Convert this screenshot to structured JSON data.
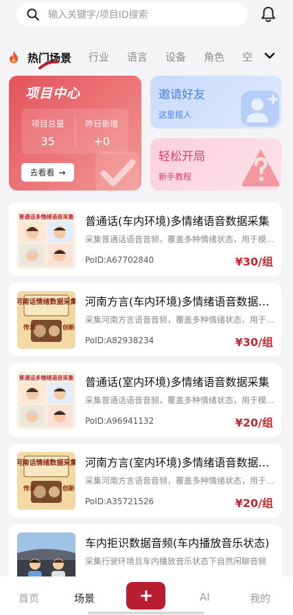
{
  "search": {
    "placeholder": "输入关键字/项目ID搜索",
    "icon": "search-icon"
  },
  "tabs": [
    {
      "label": "热门场景",
      "active": true
    },
    {
      "label": "行业",
      "active": false
    },
    {
      "label": "语言",
      "active": false
    },
    {
      "label": "设备",
      "active": false
    },
    {
      "label": "角色",
      "active": false
    },
    {
      "label": "空",
      "active": false
    }
  ],
  "project_center": {
    "title": "项目中心",
    "total_label": "项目总量",
    "total_value": "35",
    "new_label": "昨日新增",
    "new_value": "+0",
    "button_label": "去看看",
    "button_arrow": "→"
  },
  "invite": {
    "title": "邀请好友",
    "subtitle": "这里摇人"
  },
  "start": {
    "title": "轻松开局",
    "subtitle": "新手教程"
  },
  "items": [
    {
      "title": "普通话(车内环境)多情绪语音数据采集",
      "desc": "采集普通话语音音频，覆盖多种情绪状态，用于模型训练",
      "poid": "PoID:A67702840",
      "price": "¥30/组",
      "thumb_text": "普通话多情绪语音采集",
      "thumb": "mandarin"
    },
    {
      "title": "河南方言(车内环境)多情绪语音数据采集",
      "desc": "采集河南方言语音音频，覆盖多种情绪状态，用于模型训练",
      "poid": "PoID:A82938234",
      "price": "¥30/组",
      "thumb_text": "河南话情绪数据采集",
      "thumb_left": "传承",
      "thumb_right": "创新",
      "thumb": "henan"
    },
    {
      "title": "普通话(室内环境)多情绪语音数据采集",
      "desc": "采集普通话语音音频，覆盖多种情绪状态，用于模型训练",
      "poid": "PoID:A96941132",
      "price": "¥20/组",
      "thumb_text": "普通话多情绪语音采集",
      "thumb": "mandarin"
    },
    {
      "title": "河南方言(室内环境)多情绪语音数据采集",
      "desc": "采集河南方言语音音频，覆盖多种情绪状态，用于模型训练",
      "poid": "PoID:A35721526",
      "price": "¥20/组",
      "thumb_text": "河南话情绪数据采集",
      "thumb_left": "传承",
      "thumb_right": "创新",
      "thumb": "henan"
    },
    {
      "title": "车内拒识数据音频(车内播放音乐状态)",
      "desc": "采集行驶环境且车内播放音乐状态下自然闲聊音频",
      "poid": "",
      "price": "",
      "thumb": "car"
    }
  ],
  "bottom_nav": [
    {
      "label": "首页",
      "active": false
    },
    {
      "label": "场景",
      "active": true
    },
    {
      "label": "+",
      "active": false
    },
    {
      "label": "AI",
      "active": false
    },
    {
      "label": "我的",
      "active": false
    }
  ],
  "colors": {
    "accent": "#b91d32",
    "price": "#c2262e",
    "invite": "#4b82e8",
    "start": "#e03f6c"
  }
}
